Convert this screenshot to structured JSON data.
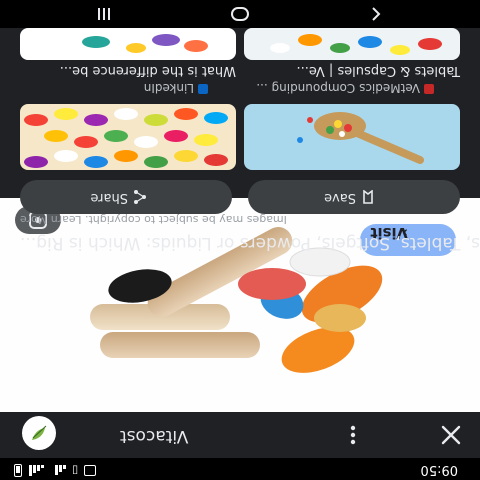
{
  "status_bar": {
    "time": "09:50"
  },
  "app_bar": {
    "site_name": "Vitacost",
    "close_icon": "close-icon",
    "more_icon": "more-vert-icon"
  },
  "result": {
    "visit_label": "Visit",
    "visit_chevron": "›",
    "title": "Capsules, Tablets, Softgels, Powders or Liquids: Which is Rig...",
    "copyright_note": "Images may be subject to copyright. Learn More",
    "save_label": "Save",
    "share_label": "Share"
  },
  "related": [
    {
      "source": "VetMedics Compounding ...",
      "caption": "Tablets & Capsules | Ve..."
    },
    {
      "source": "LinkedIn",
      "caption": "What is the difference be..."
    }
  ],
  "colors": {
    "visit_button": "#8ab4f8",
    "background": "#202124",
    "button_bg": "#3c4043"
  }
}
